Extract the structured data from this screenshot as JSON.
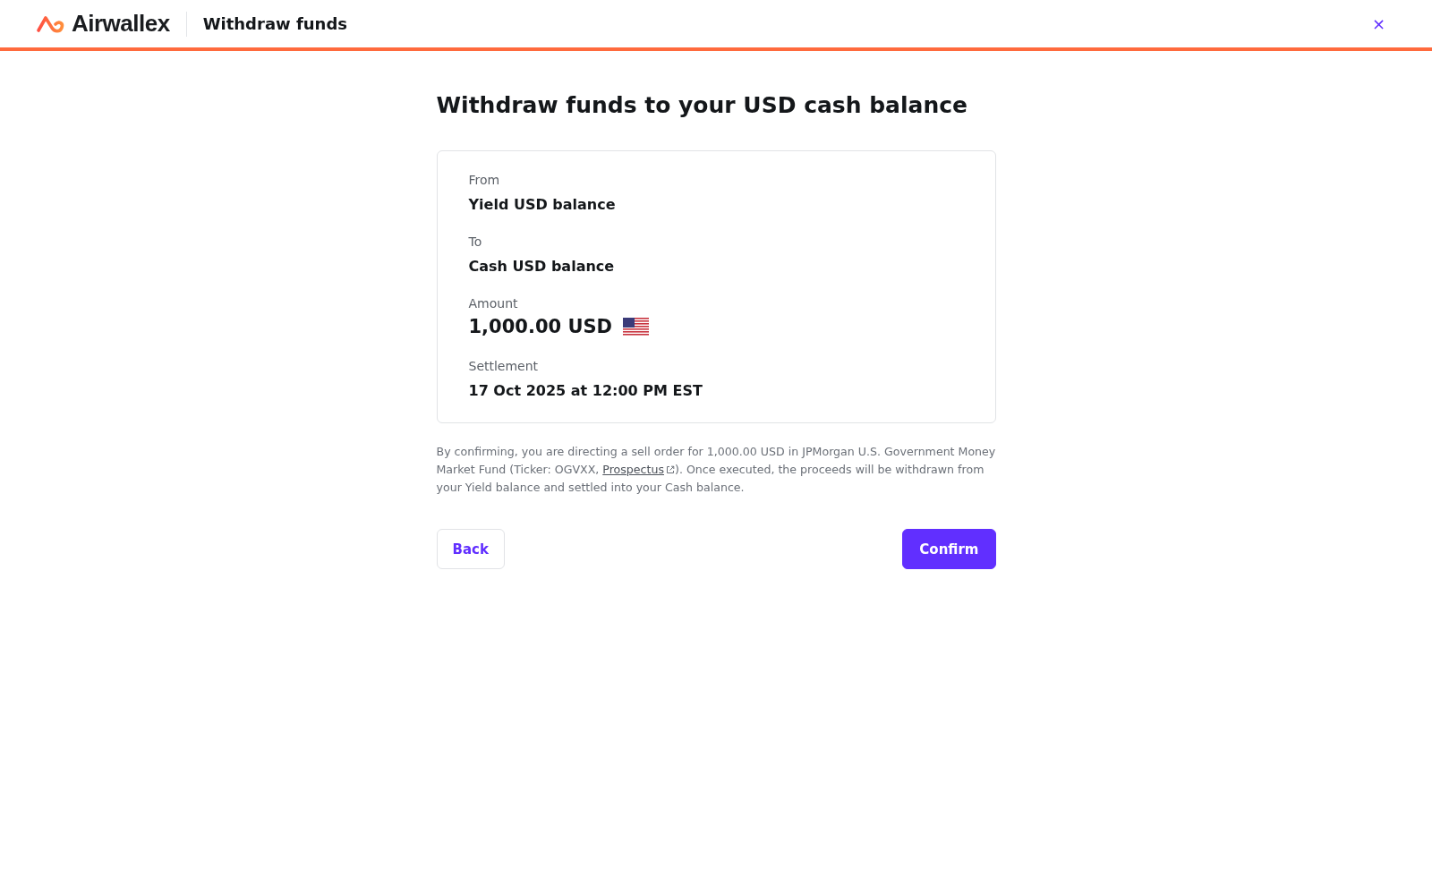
{
  "header": {
    "brand": "Airwallex",
    "title": "Withdraw funds",
    "close": "×"
  },
  "heading": "Withdraw funds to your USD cash balance",
  "fields": [
    {
      "kind": "text",
      "label": "From",
      "value": "Yield USD balance"
    },
    {
      "kind": "text",
      "label": "To",
      "value": "Cash USD balance"
    },
    {
      "kind": "amount",
      "label": "Amount",
      "value": "1,000.00 USD"
    },
    {
      "kind": "text",
      "label": "Settlement",
      "value": "17 Oct 2025 at 12:00 PM EST"
    }
  ],
  "disclaimer": {
    "before": "By confirming, you are directing a sell order for 1,000.00 USD in JPMorgan U.S. Government Money Market Fund (Ticker: OGVXX, ",
    "link": "Prospectus",
    "after": "). Once executed, the proceeds will be withdrawn from your Yield balance and settled into your Cash balance."
  },
  "buttons": [
    {
      "kind": "secondary",
      "label": "Back"
    },
    {
      "kind": "primary",
      "label": "Confirm"
    }
  ]
}
